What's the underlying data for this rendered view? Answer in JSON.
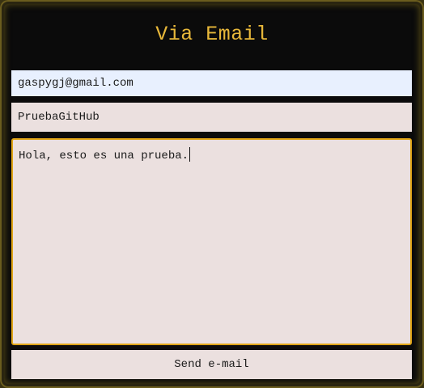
{
  "header": {
    "title": "Via Email"
  },
  "form": {
    "email_value": "gaspygj@gmail.com",
    "subject_value": "PruebaGitHub",
    "message_value": "Hola, esto es una prueba.",
    "send_label": "Send e-mail"
  },
  "colors": {
    "title": "#e8b83a",
    "panel": "#0b0b0b",
    "focus_border": "#e0a516",
    "autofill_bg": "#e8f0fe",
    "field_bg": "#ebe0df"
  }
}
